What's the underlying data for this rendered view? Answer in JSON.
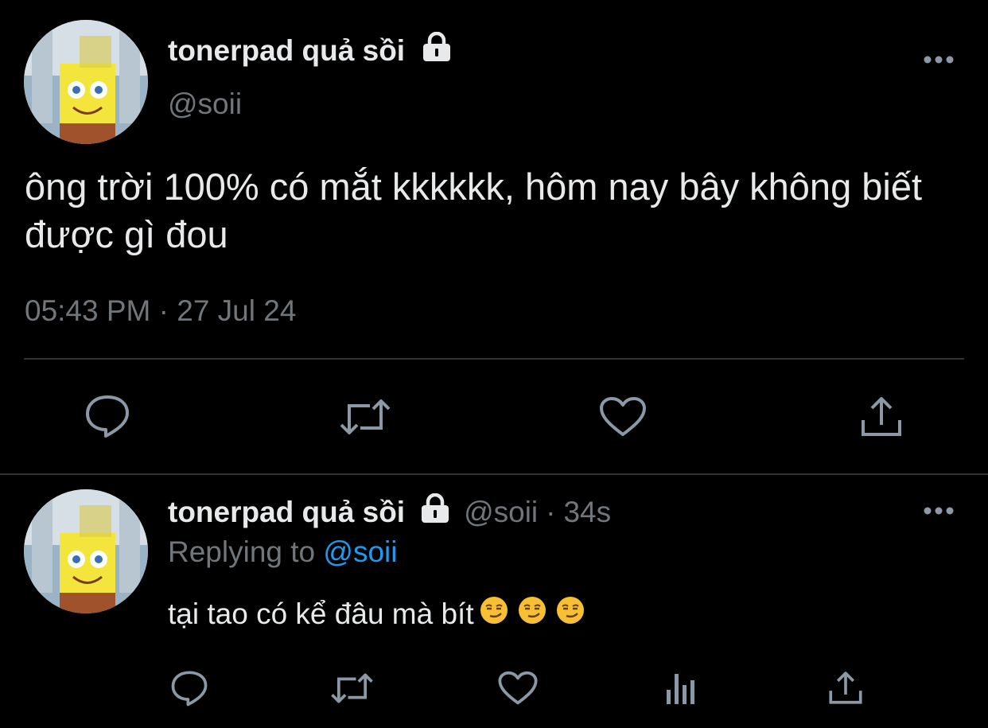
{
  "main_tweet": {
    "display_name": "tonerpad quả sồi",
    "handle": "@soii",
    "text": "ông trời 100% có mắt kkkkkk, hôm nay bây không biết được gì đou",
    "timestamp": "05:43 PM · 27 Jul 24",
    "icons": [
      "lock-icon",
      "more-icon",
      "reply-icon",
      "retweet-icon",
      "like-icon",
      "share-icon"
    ]
  },
  "reply_tweet": {
    "display_name": "tonerpad quả sồi",
    "handle": "@soii",
    "separator": "·",
    "time": "34s",
    "replying_prefix": "Replying to",
    "replying_handle": "@soii",
    "text": "tại tao có kể đâu mà bít",
    "emoji_count": 3,
    "icons": [
      "lock-icon",
      "more-icon",
      "reply-icon",
      "retweet-icon",
      "like-icon",
      "analytics-icon",
      "share-icon"
    ]
  },
  "colors": {
    "background": "#000000",
    "text_primary": "#e7e9ea",
    "text_secondary": "#71767b",
    "link": "#1d9bf0",
    "divider": "#2f3336"
  }
}
